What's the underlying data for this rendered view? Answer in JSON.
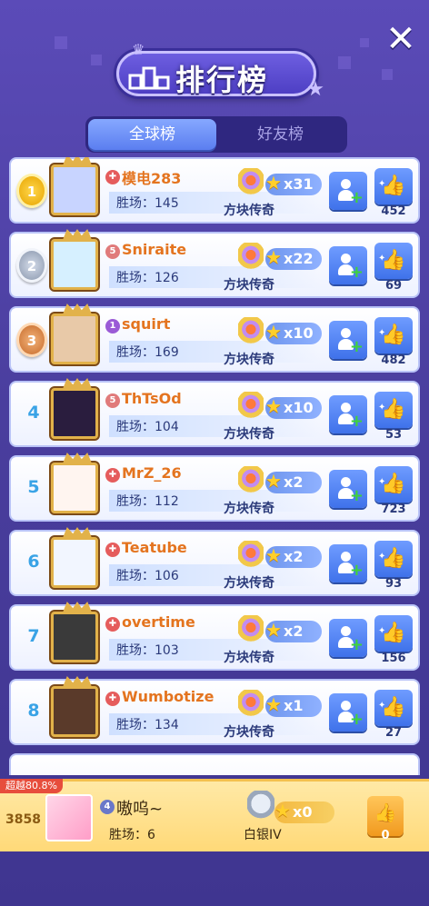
{
  "header": {
    "title": "排行榜",
    "close_icon": "close-icon"
  },
  "tabs": [
    {
      "label": "全球榜",
      "active": true
    },
    {
      "label": "好友榜",
      "active": false
    }
  ],
  "players": [
    {
      "rank": "1",
      "name": "模电283",
      "wins": "胜场：145",
      "tier": "方块传奇",
      "stars": "x31",
      "likes": "452",
      "level_color": "#e55c5c"
    },
    {
      "rank": "2",
      "name": "Sniraite",
      "wins": "胜场：126",
      "tier": "方块传奇",
      "stars": "x22",
      "likes": "69",
      "level_color": "#e07a7a"
    },
    {
      "rank": "3",
      "name": "squirt",
      "wins": "胜场：169",
      "tier": "方块传奇",
      "stars": "x10",
      "likes": "482",
      "level_color": "#9a5bd6"
    },
    {
      "rank": "4",
      "name": "ThTsOd",
      "wins": "胜场：104",
      "tier": "方块传奇",
      "stars": "x10",
      "likes": "53",
      "level_color": "#e07a7a"
    },
    {
      "rank": "5",
      "name": "MrZ_26",
      "wins": "胜场：112",
      "tier": "方块传奇",
      "stars": "x2",
      "likes": "723",
      "level_color": "#e55c5c"
    },
    {
      "rank": "6",
      "name": "Teatube",
      "wins": "胜场：106",
      "tier": "方块传奇",
      "stars": "x2",
      "likes": "93",
      "level_color": "#e55c5c"
    },
    {
      "rank": "7",
      "name": "overtime",
      "wins": "胜场：103",
      "tier": "方块传奇",
      "stars": "x2",
      "likes": "156",
      "level_color": "#e55c5c"
    },
    {
      "rank": "8",
      "name": "Wumbotize",
      "wins": "胜场：134",
      "tier": "方块传奇",
      "stars": "x1",
      "likes": "27",
      "level_color": "#e55c5c"
    }
  ],
  "self": {
    "tag": "超越80.8%",
    "score": "3858",
    "level": "4",
    "name": "嗷呜~",
    "wins": "胜场：6",
    "tier": "白银IV",
    "stars": "x0",
    "likes": "0"
  },
  "level_glyphs": {
    "1": "✚",
    "2": "5",
    "3": "1",
    "4": "5",
    "5": "✚",
    "6": "✚",
    "7": "✚",
    "8": "✚"
  },
  "colors": {
    "background": "#4a3e9e",
    "name_highlight": "#e4741f",
    "button_blue": "#3f72ea",
    "self_bar": "#ffd978"
  }
}
